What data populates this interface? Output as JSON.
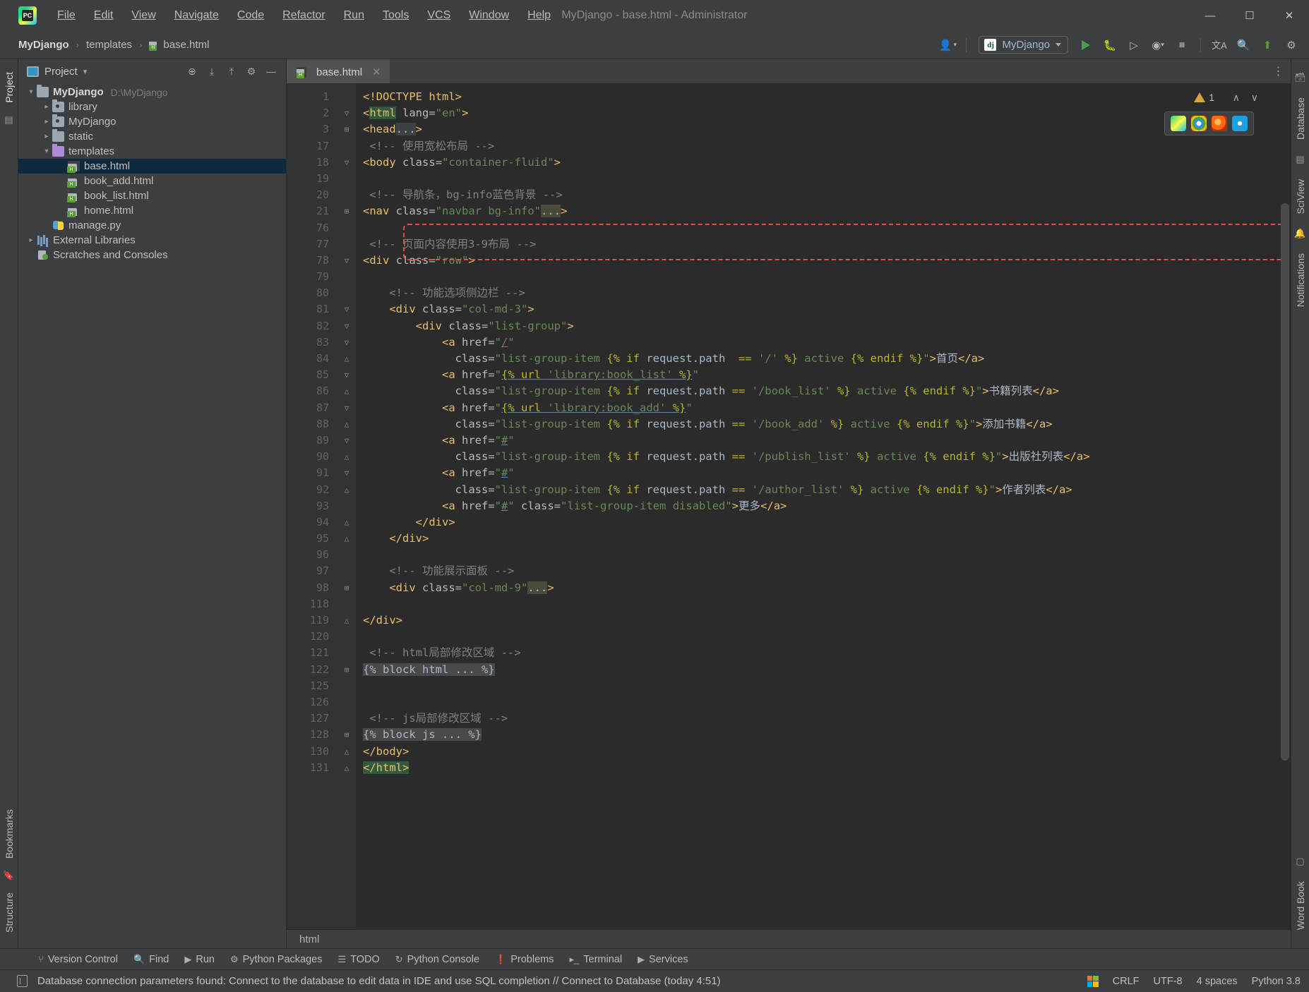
{
  "titlebar": {
    "logo_text": "PC",
    "window_title": "MyDjango - base.html - Administrator",
    "menus": [
      "File",
      "Edit",
      "View",
      "Navigate",
      "Code",
      "Refactor",
      "Run",
      "Tools",
      "VCS",
      "Window",
      "Help"
    ],
    "minimize": "—",
    "maximize": "☐",
    "close": "✕"
  },
  "navbar": {
    "breadcrumbs": [
      "MyDjango",
      "templates",
      "base.html"
    ],
    "separator": "›",
    "profile_icon": "user-icon",
    "run_config": {
      "icon_text": "dj",
      "name": "MyDjango",
      "caret": "▾"
    },
    "actions": {
      "run": "▶",
      "debug": "🐞",
      "coverage": "⏵",
      "profile": "⊙",
      "stop": "■",
      "translate": "文A",
      "search": "🔍",
      "updates": "⬆",
      "settings": "⚙"
    }
  },
  "left_strip": {
    "project_tab": "Project",
    "bookmarks_tab": "Bookmarks",
    "structure_tab": "Structure"
  },
  "right_strip": {
    "database_tab": "Database",
    "sciview_tab": "SciView",
    "notifications_tab": "Notifications",
    "wordbook_tab": "Word Book"
  },
  "project_panel": {
    "title": "Project",
    "caret": "▾",
    "actions": {
      "locate": "⊕",
      "expand_all": "⤓",
      "collapse_all": "⤒",
      "settings": "⚙",
      "hide": "—"
    },
    "tree": [
      {
        "label": "MyDjango",
        "path": "D:\\MyDjango",
        "icon": "folder-icon",
        "indent": 0,
        "arrow": "open",
        "bold": true,
        "selected": false
      },
      {
        "label": "library",
        "path": "",
        "icon": "module-icon",
        "indent": 1,
        "arrow": "closed",
        "bold": false,
        "selected": false
      },
      {
        "label": "MyDjango",
        "path": "",
        "icon": "module-icon",
        "indent": 1,
        "arrow": "closed",
        "bold": false,
        "selected": false
      },
      {
        "label": "static",
        "path": "",
        "icon": "folder-icon",
        "indent": 1,
        "arrow": "closed",
        "bold": false,
        "selected": false
      },
      {
        "label": "templates",
        "path": "",
        "icon": "template-folder-icon",
        "indent": 1,
        "arrow": "open",
        "bold": false,
        "selected": false
      },
      {
        "label": "base.html",
        "path": "",
        "icon": "html-file-icon",
        "indent": 2,
        "arrow": "none",
        "bold": false,
        "selected": true
      },
      {
        "label": "book_add.html",
        "path": "",
        "icon": "html-file-icon",
        "indent": 2,
        "arrow": "none",
        "bold": false,
        "selected": false
      },
      {
        "label": "book_list.html",
        "path": "",
        "icon": "html-file-icon",
        "indent": 2,
        "arrow": "none",
        "bold": false,
        "selected": false
      },
      {
        "label": "home.html",
        "path": "",
        "icon": "html-file-icon",
        "indent": 2,
        "arrow": "none",
        "bold": false,
        "selected": false
      },
      {
        "label": "manage.py",
        "path": "",
        "icon": "python-file-icon",
        "indent": 1,
        "arrow": "none",
        "bold": false,
        "selected": false
      },
      {
        "label": "External Libraries",
        "path": "",
        "icon": "library-icon",
        "indent": 0,
        "arrow": "closed",
        "bold": false,
        "selected": false
      },
      {
        "label": "Scratches and Consoles",
        "path": "",
        "icon": "scratches-icon",
        "indent": 0,
        "arrow": "none",
        "bold": false,
        "selected": false
      }
    ]
  },
  "editor": {
    "tab_label": "base.html",
    "tab_close": "✕",
    "tabs_menu": "⋮",
    "warning_count": "1",
    "chevron_up": "∧",
    "chevron_down": "∨",
    "tag_breadcrumb": "html",
    "browser_icons": [
      "pycharm-icon",
      "chrome-icon",
      "firefox-icon",
      "edge-icon"
    ],
    "lines": [
      {
        "num": "1",
        "fold": "",
        "html": "<span class='tok-doct'>&lt;!DOCTYPE html&gt;</span>"
      },
      {
        "num": "2",
        "fold": "v",
        "html": "<span class='tok-tag'>&lt;</span><span class='tok-tag hl-html'>html</span> <span class='tok-attr'>lang</span><span class='tok-punc'>=</span><span class='tok-str'>\"en\"</span><span class='tok-tag'>&gt;</span>"
      },
      {
        "num": "3",
        "fold": "+",
        "html": "<span class='tok-tag'>&lt;head</span><span class='hl-fold2'>...</span><span class='tok-tag'>&gt;</span>"
      },
      {
        "num": "17",
        "fold": "",
        "html": " <span class='tok-cmt'>&lt;!-- 使用宽松布局 --&gt;</span>"
      },
      {
        "num": "18",
        "fold": "v",
        "html": "<span class='tok-tag'>&lt;body</span> <span class='tok-attr'>class</span><span class='tok-punc'>=</span><span class='tok-str'>\"container-fluid\"</span><span class='tok-tag'>&gt;</span>"
      },
      {
        "num": "19",
        "fold": "",
        "html": ""
      },
      {
        "num": "20",
        "fold": "",
        "html": " <span class='tok-cmt'>&lt;!-- 导航条，bg-info蓝色背景 --&gt;</span>"
      },
      {
        "num": "21",
        "fold": "+",
        "html": "<span class='tok-tag'>&lt;nav</span> <span class='tok-attr'>class</span><span class='tok-punc'>=</span><span class='tok-str'>\"navbar bg-info\"</span><span class='hl-fold'>...</span><span class='tok-tag'>&gt;</span>"
      },
      {
        "num": "76",
        "fold": "",
        "html": ""
      },
      {
        "num": "77",
        "fold": "",
        "html": " <span class='tok-cmt'>&lt;!-- 页面内容使用3-9布局 --&gt;</span>"
      },
      {
        "num": "78",
        "fold": "v",
        "html": "<span class='tok-tag'>&lt;div</span> <span class='tok-attr'>class</span><span class='tok-punc'>=</span><span class='tok-str'>\"row\"</span><span class='tok-tag'>&gt;</span>"
      },
      {
        "num": "79",
        "fold": "",
        "html": ""
      },
      {
        "num": "80",
        "fold": "",
        "html": "    <span class='tok-cmt'>&lt;!-- 功能选项侧边栏 --&gt;</span>"
      },
      {
        "num": "81",
        "fold": "v",
        "html": "    <span class='tok-tag'>&lt;div</span> <span class='tok-attr'>class</span><span class='tok-punc'>=</span><span class='tok-str'>\"col-md-3\"</span><span class='tok-tag'>&gt;</span>"
      },
      {
        "num": "82",
        "fold": "v",
        "html": "        <span class='tok-tag'>&lt;div</span> <span class='tok-attr'>class</span><span class='tok-punc'>=</span><span class='tok-str'>\"list-group\"</span><span class='tok-tag'>&gt;</span>"
      },
      {
        "num": "83",
        "fold": "v",
        "html": "            <span class='tok-tag'>&lt;a</span> <span class='tok-attr'>href</span><span class='tok-punc'>=</span><span class='tok-str'>\"</span><span class='tok-str ul'>/</span><span class='tok-str'>\"</span>"
      },
      {
        "num": "84",
        "fold": "^",
        "html": "              <span class='tok-attr'>class</span><span class='tok-punc'>=</span><span class='tok-str'>\"list-group-item </span><span class='tok-dj'>{% if </span><span class='tok-txt'>request.path</span><span class='tok-dj'>  == </span><span class='tok-djs'>'/'</span><span class='tok-dj'> %}</span><span class='tok-str'> active </span><span class='tok-dj'>{% endif %}</span><span class='tok-str'>\"</span><span class='tok-tag'>&gt;</span><span class='tok-txt'>首页</span><span class='tok-tag'>&lt;/a&gt;</span>"
      },
      {
        "num": "85",
        "fold": "v",
        "html": "            <span class='tok-tag'>&lt;a</span> <span class='tok-attr'>href</span><span class='tok-punc'>=</span><span class='tok-str'>\"</span><span class='tok-dj ul'>{% url </span><span class='tok-djs ul'>'library:book_list'</span><span class='tok-dj ul'> %}</span><span class='tok-str'>\"</span>"
      },
      {
        "num": "86",
        "fold": "^",
        "html": "              <span class='tok-attr'>class</span><span class='tok-punc'>=</span><span class='tok-str'>\"list-group-item </span><span class='tok-dj'>{% if </span><span class='tok-txt'>request.path</span><span class='tok-dj'> == </span><span class='tok-djs'>'/book_list'</span><span class='tok-dj'> %}</span><span class='tok-str'> active </span><span class='tok-dj'>{% endif %}</span><span class='tok-str'>\"</span><span class='tok-tag'>&gt;</span><span class='tok-txt'>书籍列表</span><span class='tok-tag'>&lt;/a&gt;</span>"
      },
      {
        "num": "87",
        "fold": "v",
        "html": "            <span class='tok-tag'>&lt;a</span> <span class='tok-attr'>href</span><span class='tok-punc'>=</span><span class='tok-str'>\"</span><span class='tok-dj ul'>{% url </span><span class='tok-djs ul'>'library:book_add'</span><span class='tok-dj ul'> %}</span><span class='tok-str'>\"</span>"
      },
      {
        "num": "88",
        "fold": "^",
        "html": "              <span class='tok-attr'>class</span><span class='tok-punc'>=</span><span class='tok-str'>\"list-group-item </span><span class='tok-dj'>{% if </span><span class='tok-txt'>request.path</span><span class='tok-dj'> == </span><span class='tok-djs'>'/book_add'</span><span class='tok-dj'> %}</span><span class='tok-str'> active </span><span class='tok-dj'>{% endif %}</span><span class='tok-str'>\"</span><span class='tok-tag'>&gt;</span><span class='tok-txt'>添加书籍</span><span class='tok-tag'>&lt;/a&gt;</span>"
      },
      {
        "num": "89",
        "fold": "v",
        "html": "            <span class='tok-tag'>&lt;a</span> <span class='tok-attr'>href</span><span class='tok-punc'>=</span><span class='tok-str'>\"</span><span class='tok-str ul'>#</span><span class='tok-str'>\"</span>"
      },
      {
        "num": "90",
        "fold": "^",
        "html": "              <span class='tok-attr'>class</span><span class='tok-punc'>=</span><span class='tok-str'>\"list-group-item </span><span class='tok-dj'>{% if </span><span class='tok-txt'>request.path</span><span class='tok-dj'> == </span><span class='tok-djs'>'/publish_list'</span><span class='tok-dj'> %}</span><span class='tok-str'> active </span><span class='tok-dj'>{% endif %}</span><span class='tok-str'>\"</span><span class='tok-tag'>&gt;</span><span class='tok-txt'>出版社列表</span><span class='tok-tag'>&lt;/a&gt;</span>"
      },
      {
        "num": "91",
        "fold": "v",
        "html": "            <span class='tok-tag'>&lt;a</span> <span class='tok-attr'>href</span><span class='tok-punc'>=</span><span class='tok-str'>\"</span><span class='tok-str ul'>#</span><span class='tok-str'>\"</span>"
      },
      {
        "num": "92",
        "fold": "^",
        "html": "              <span class='tok-attr'>class</span><span class='tok-punc'>=</span><span class='tok-str'>\"list-group-item </span><span class='tok-dj'>{% if </span><span class='tok-txt'>request.path</span><span class='tok-dj'> == </span><span class='tok-djs'>'/author_list'</span><span class='tok-dj'> %}</span><span class='tok-str'> active </span><span class='tok-dj'>{% endif %}</span><span class='tok-str'>\"</span><span class='tok-tag'>&gt;</span><span class='tok-txt'>作者列表</span><span class='tok-tag'>&lt;/a&gt;</span>"
      },
      {
        "num": "93",
        "fold": "",
        "html": "            <span class='tok-tag'>&lt;a</span> <span class='tok-attr'>href</span><span class='tok-punc'>=</span><span class='tok-str'>\"</span><span class='tok-str ul'>#</span><span class='tok-str'>\"</span> <span class='tok-attr'>class</span><span class='tok-punc'>=</span><span class='tok-str'>\"list-group-item disabled\"</span><span class='tok-tag'>&gt;</span><span class='tok-txt'>更多</span><span class='tok-tag'>&lt;/a&gt;</span>"
      },
      {
        "num": "94",
        "fold": "^",
        "html": "        <span class='tok-tag'>&lt;/div&gt;</span>"
      },
      {
        "num": "95",
        "fold": "^",
        "html": "    <span class='tok-tag'>&lt;/div&gt;</span>"
      },
      {
        "num": "96",
        "fold": "",
        "html": ""
      },
      {
        "num": "97",
        "fold": "",
        "html": "    <span class='tok-cmt'>&lt;!-- 功能展示面板 --&gt;</span>"
      },
      {
        "num": "98",
        "fold": "+",
        "html": "    <span class='tok-tag'>&lt;div</span> <span class='tok-attr'>class</span><span class='tok-punc'>=</span><span class='tok-str'>\"col-md-9\"</span><span class='hl-fold'>...</span><span class='tok-tag'>&gt;</span>"
      },
      {
        "num": "118",
        "fold": "",
        "html": ""
      },
      {
        "num": "119",
        "fold": "^",
        "html": "<span class='tok-tag'>&lt;/div&gt;</span>"
      },
      {
        "num": "120",
        "fold": "",
        "html": ""
      },
      {
        "num": "121",
        "fold": "",
        "html": " <span class='tok-cmt'>&lt;!-- html局部修改区域 --&gt;</span>"
      },
      {
        "num": "122",
        "fold": "+",
        "html": "<span class='hl-block'>{% block html ... %}</span>"
      },
      {
        "num": "125",
        "fold": "",
        "html": ""
      },
      {
        "num": "126",
        "fold": "",
        "html": ""
      },
      {
        "num": "127",
        "fold": "",
        "html": " <span class='tok-cmt'>&lt;!-- js局部修改区域 --&gt;</span>"
      },
      {
        "num": "128",
        "fold": "+",
        "html": "<span class='hl-block'>{% block js ... %}</span>"
      },
      {
        "num": "130",
        "fold": "^",
        "html": "<span class='tok-tag'>&lt;/body&gt;</span>"
      },
      {
        "num": "131",
        "fold": "^",
        "html": "<span class='tok-tag hl-html'>&lt;/html&gt;</span>"
      }
    ]
  },
  "toolwindows": [
    {
      "label": "Version Control",
      "icon": "⑂"
    },
    {
      "label": "Find",
      "icon": "🔍"
    },
    {
      "label": "Run",
      "icon": "▶"
    },
    {
      "label": "Python Packages",
      "icon": "⚙"
    },
    {
      "label": "TODO",
      "icon": "☰"
    },
    {
      "label": "Python Console",
      "icon": "↻"
    },
    {
      "label": "Problems",
      "icon": "❗"
    },
    {
      "label": "Terminal",
      "icon": "▸_"
    },
    {
      "label": "Services",
      "icon": "▶"
    }
  ],
  "statusbar": {
    "message": "Database connection parameters found: Connect to the database to edit data in IDE and use SQL completion // Connect to Database (today 4:51)",
    "line_sep": "CRLF",
    "encoding": "UTF-8",
    "indent": "4 spaces",
    "interpreter": "Python 3.8"
  }
}
